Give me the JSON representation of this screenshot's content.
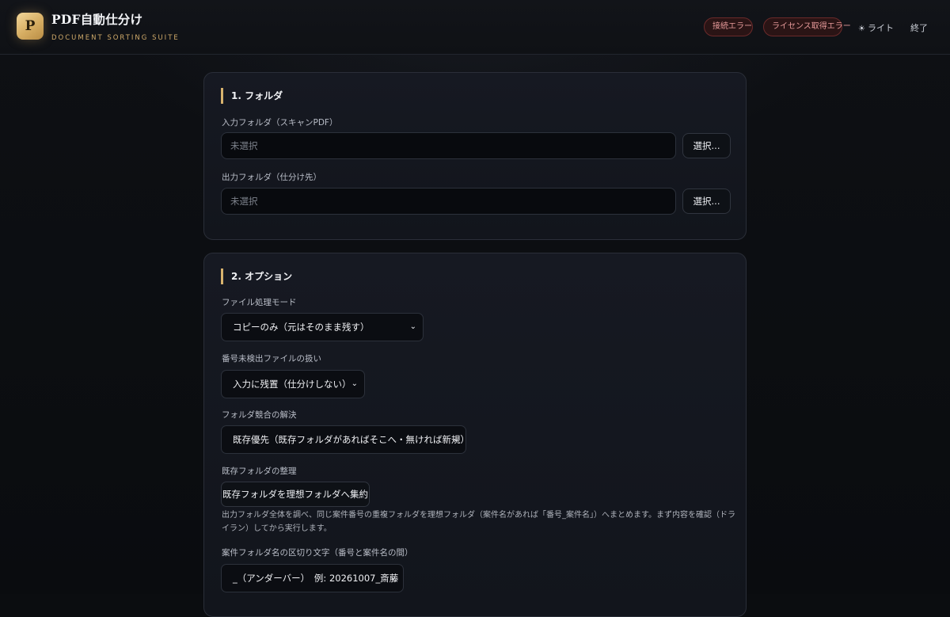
{
  "header": {
    "logo_letter": "P",
    "title": "PDF自動仕分け",
    "subtitle": "DOCUMENT SORTING SUITE",
    "badges": [
      "接続エラー",
      "ライセンス取得エラー"
    ],
    "theme_icon": "☀",
    "theme_label": "ライト",
    "quit_label": "終了"
  },
  "folders": {
    "title": "1. フォルダ",
    "input_label": "入力フォルダ（スキャンPDF）",
    "input_placeholder": "未選択",
    "input_button": "選択...",
    "output_label": "出力フォルダ（仕分け先）",
    "output_placeholder": "未選択",
    "output_button": "選択..."
  },
  "options": {
    "title": "2. オプション",
    "mode_label": "ファイル処理モード",
    "mode_value": "コピーのみ（元はそのまま残す）",
    "undetected_label": "番号未検出ファイルの扱い",
    "undetected_value": "入力に残置（仕分けしない）",
    "conflict_label": "フォルダ競合の解決",
    "conflict_value": "既存優先（既存フォルダがあればそこへ・無ければ新規）",
    "organize_label": "既存フォルダの整理",
    "organize_button": "既存フォルダを理想フォルダへ集約",
    "organize_help": "出力フォルダ全体を調べ、同じ案件番号の重複フォルダを理想フォルダ（案件名があれば「番号_案件名」）へまとめます。まず内容を確認（ドライラン）してから実行します。",
    "separator_label": "案件フォルダ名の区切り文字（番号と案件名の間）",
    "separator_value": "_（アンダーバー）　例: 20261007_斎藤"
  },
  "icons": {
    "dropdown_chevron": "chevron-down-icon",
    "theme": "sun-icon"
  },
  "colors": {
    "accent_gold": "#d8b36e",
    "error_badge_text": "#e79a9a",
    "background": "#0b0d10"
  }
}
